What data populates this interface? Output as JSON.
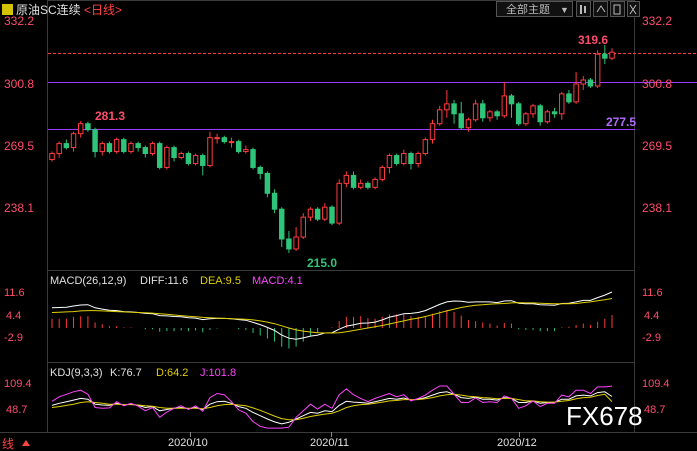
{
  "header": {
    "title": "原油SC连续",
    "period": "<日线>",
    "theme_button": "全部主题",
    "theme_arrow": "▼"
  },
  "main_panel": {
    "y_ticks": [
      "332.2",
      "300.8",
      "269.5",
      "238.1"
    ],
    "annotations": {
      "high_left": "281.3",
      "low": "215.0",
      "high_right": "319.6",
      "support": "277.5"
    }
  },
  "macd_panel": {
    "label": "MACD(26,12,9)",
    "diff": "DIFF:11.6",
    "dea": "DEA:9.5",
    "macd": "MACD:4.1",
    "ticks": [
      "11.6",
      "4.4",
      "-2.9"
    ]
  },
  "kdj_panel": {
    "label": "KDJ(9,3,3)",
    "k": "K:76.7",
    "d": "D:64.2",
    "j": "J:101.8",
    "ticks": [
      "109.4",
      "48.7"
    ]
  },
  "x_axis": {
    "dates": [
      "2020/10",
      "2020/11",
      "2020/12"
    ]
  },
  "footer": {
    "left_text": "线",
    "watermark": "FX678"
  },
  "colors": {
    "up": "#ff3b3b",
    "down": "#2ec47a",
    "purple_line": "#9a3bff",
    "price_line": "#ff3b3b",
    "macd_diff": "#ffffff",
    "macd_dea": "#e0d000",
    "macd_label": "#ff44ff",
    "kdj_j": "#ff44ff"
  },
  "chart_data": {
    "type": "candlestick",
    "title": "原油SC连续 日线",
    "ylim": [
      206,
      340
    ],
    "reference_lines": [
      300.8,
      277.5,
      315.6
    ],
    "candles": [
      [
        262.0,
        265.0,
        261.0,
        266.0
      ],
      [
        265.0,
        270.0,
        263.0,
        271.0
      ],
      [
        270.0,
        268.0,
        267.0,
        272.0
      ],
      [
        268.0,
        275.0,
        266.0,
        276.0
      ],
      [
        275.0,
        280.0,
        273.0,
        281.3
      ],
      [
        280.0,
        277.0,
        276.0,
        281.0
      ],
      [
        277.0,
        266.0,
        263.0,
        278.0
      ],
      [
        266.0,
        270.0,
        264.0,
        271.0
      ],
      [
        270.0,
        266.0,
        265.0,
        271.0
      ],
      [
        266.0,
        272.0,
        265.0,
        273.0
      ],
      [
        272.0,
        266.0,
        265.0,
        273.0
      ],
      [
        266.0,
        270.0,
        265.0,
        271.0
      ],
      [
        270.0,
        268.0,
        266.0,
        271.0
      ],
      [
        268.0,
        265.0,
        263.0,
        269.0
      ],
      [
        265.0,
        270.0,
        264.0,
        271.0
      ],
      [
        270.0,
        258.0,
        257.0,
        271.0
      ],
      [
        258.0,
        268.0,
        257.0,
        269.0
      ],
      [
        268.0,
        263.0,
        261.0,
        269.0
      ],
      [
        263.0,
        265.0,
        262.0,
        266.0
      ],
      [
        265.0,
        260.0,
        259.0,
        266.0
      ],
      [
        260.0,
        264.0,
        259.0,
        265.0
      ],
      [
        264.0,
        259.0,
        254.0,
        265.0
      ],
      [
        259.0,
        273.0,
        258.0,
        276.0
      ],
      [
        273.0,
        273.0,
        270.0,
        275.0
      ],
      [
        273.0,
        271.0,
        270.0,
        274.0
      ],
      [
        271.0,
        271.0,
        268.0,
        273.0
      ],
      [
        271.0,
        266.0,
        265.0,
        272.0
      ],
      [
        266.0,
        267.0,
        265.0,
        269.0
      ],
      [
        267.0,
        258.0,
        257.0,
        268.0
      ],
      [
        258.0,
        255.0,
        252.0,
        259.0
      ],
      [
        255.0,
        245.0,
        243.0,
        256.0
      ],
      [
        245.0,
        237.0,
        235.0,
        247.0
      ],
      [
        237.0,
        222.0,
        218.0,
        238.0
      ],
      [
        222.0,
        217.0,
        215.0,
        226.0
      ],
      [
        217.0,
        223.0,
        216.0,
        228.0
      ],
      [
        223.0,
        233.0,
        222.0,
        235.0
      ],
      [
        233.0,
        237.0,
        231.0,
        238.0
      ],
      [
        237.0,
        232.0,
        231.0,
        238.0
      ],
      [
        232.0,
        238.0,
        231.0,
        240.0
      ],
      [
        238.0,
        230.0,
        229.0,
        239.0
      ],
      [
        230.0,
        250.0,
        229.0,
        252.0
      ],
      [
        250.0,
        254.0,
        248.0,
        256.0
      ],
      [
        254.0,
        248.0,
        247.0,
        256.0
      ],
      [
        248.0,
        250.0,
        247.0,
        252.0
      ],
      [
        250.0,
        248.0,
        247.0,
        251.0
      ],
      [
        248.0,
        252.0,
        247.0,
        253.0
      ],
      [
        252.0,
        258.0,
        251.0,
        259.0
      ],
      [
        258.0,
        264.0,
        255.0,
        265.0
      ],
      [
        264.0,
        260.0,
        259.0,
        265.0
      ],
      [
        260.0,
        265.0,
        259.0,
        267.0
      ],
      [
        265.0,
        260.0,
        257.0,
        266.0
      ],
      [
        260.0,
        265.0,
        258.0,
        266.0
      ],
      [
        265.0,
        272.0,
        264.0,
        273.0
      ],
      [
        272.0,
        280.0,
        270.0,
        282.0
      ],
      [
        280.0,
        287.0,
        279.0,
        289.0
      ],
      [
        287.0,
        290.0,
        283.0,
        297.0
      ],
      [
        290.0,
        285.0,
        280.0,
        292.0
      ],
      [
        285.0,
        278.0,
        277.0,
        291.0
      ],
      [
        278.0,
        282.0,
        276.0,
        283.0
      ],
      [
        282.0,
        290.0,
        281.0,
        292.0
      ],
      [
        290.0,
        283.0,
        281.0,
        292.0
      ],
      [
        283.0,
        286.0,
        281.0,
        287.0
      ],
      [
        286.0,
        284.0,
        282.0,
        287.0
      ],
      [
        284.0,
        294.0,
        283.0,
        301.0
      ],
      [
        294.0,
        290.0,
        283.0,
        295.0
      ],
      [
        290.0,
        280.0,
        279.0,
        291.0
      ],
      [
        280.0,
        285.0,
        279.0,
        286.0
      ],
      [
        285.0,
        289.0,
        283.0,
        290.0
      ],
      [
        289.0,
        281.0,
        279.0,
        290.0
      ],
      [
        281.0,
        286.0,
        280.0,
        287.0
      ],
      [
        286.0,
        285.0,
        283.0,
        288.0
      ],
      [
        285.0,
        295.0,
        282.0,
        296.0
      ],
      [
        295.0,
        291.0,
        290.0,
        297.0
      ],
      [
        291.0,
        300.0,
        290.0,
        306.0
      ],
      [
        300.0,
        302.0,
        297.0,
        304.0
      ],
      [
        302.0,
        299.0,
        298.0,
        303.0
      ],
      [
        299.0,
        315.0,
        298.0,
        317.0
      ],
      [
        315.0,
        313.0,
        310.0,
        319.6
      ],
      [
        313.0,
        316.0,
        312.0,
        318.0
      ]
    ],
    "macd": {
      "series": [
        {
          "name": "DIFF",
          "values": [
            6.5,
            6.6,
            6.7,
            7.1,
            7.4,
            7.5,
            6.5,
            6.1,
            5.7,
            5.6,
            5.3,
            5.2,
            5.0,
            4.7,
            4.6,
            4.0,
            3.9,
            3.7,
            3.6,
            3.3,
            3.2,
            2.7,
            3.0,
            3.1,
            3.1,
            3.0,
            2.7,
            2.5,
            1.8,
            1.1,
            0.2,
            -0.8,
            -2.3,
            -3.3,
            -3.6,
            -3.2,
            -2.6,
            -2.3,
            -1.6,
            -1.5,
            -0.4,
            0.6,
            1.0,
            1.5,
            1.6,
            1.9,
            2.6,
            3.5,
            4.0,
            4.6,
            4.7,
            5.0,
            5.6,
            6.6,
            7.6,
            8.4,
            8.7,
            8.6,
            8.3,
            8.4,
            8.4,
            8.4,
            8.2,
            8.7,
            8.8,
            8.0,
            7.8,
            7.8,
            7.5,
            7.4,
            7.3,
            7.9,
            8.0,
            8.4,
            8.9,
            8.9,
            9.8,
            10.6,
            11.6
          ]
        },
        {
          "name": "DEA",
          "values": [
            5.0,
            5.1,
            5.2,
            5.3,
            5.5,
            5.6,
            5.6,
            5.5,
            5.4,
            5.3,
            5.2,
            5.1,
            5.0,
            4.9,
            4.8,
            4.6,
            4.4,
            4.2,
            4.0,
            3.8,
            3.6,
            3.4,
            3.3,
            3.2,
            3.1,
            3.0,
            2.9,
            2.8,
            2.6,
            2.3,
            1.9,
            1.4,
            0.7,
            0.0,
            -0.6,
            -1.0,
            -1.3,
            -1.5,
            -1.6,
            -1.6,
            -1.5,
            -1.2,
            -0.8,
            -0.4,
            0.0,
            0.4,
            0.8,
            1.3,
            1.8,
            2.3,
            2.8,
            3.2,
            3.7,
            4.3,
            4.9,
            5.5,
            6.1,
            6.6,
            7.0,
            7.3,
            7.5,
            7.7,
            7.8,
            7.9,
            8.1,
            8.2,
            8.1,
            8.1,
            8.0,
            7.9,
            7.8,
            7.8,
            7.8,
            7.9,
            8.2,
            8.4,
            8.8,
            9.1,
            9.5
          ]
        }
      ],
      "labels": {
        "diff": "DIFF:11.6",
        "dea": "DEA:9.5",
        "macd": "MACD:4.1"
      }
    },
    "kdj": {
      "series": [
        {
          "name": "K",
          "values": [
            55,
            60,
            64,
            68,
            72,
            70,
            58,
            56,
            55,
            60,
            56,
            58,
            55,
            50,
            52,
            42,
            45,
            48,
            50,
            47,
            50,
            45,
            58,
            64,
            65,
            60,
            52,
            48,
            38,
            30,
            22,
            15,
            10,
            14,
            22,
            30,
            38,
            36,
            42,
            40,
            55,
            65,
            63,
            62,
            60,
            64,
            68,
            72,
            70,
            73,
            68,
            70,
            74,
            80,
            86,
            88,
            82,
            74,
            72,
            75,
            70,
            70,
            68,
            74,
            72,
            62,
            62,
            66,
            60,
            62,
            62,
            70,
            70,
            78,
            80,
            78,
            86,
            88,
            76.7
          ]
        },
        {
          "name": "D",
          "values": [
            50,
            52,
            55,
            58,
            62,
            64,
            62,
            60,
            58,
            58,
            57,
            57,
            56,
            54,
            53,
            50,
            48,
            48,
            48,
            48,
            48,
            47,
            50,
            54,
            57,
            58,
            56,
            54,
            49,
            43,
            36,
            29,
            23,
            20,
            20,
            24,
            28,
            31,
            34,
            36,
            42,
            50,
            54,
            57,
            58,
            60,
            63,
            66,
            67,
            69,
            69,
            69,
            71,
            74,
            78,
            81,
            82,
            80,
            77,
            76,
            74,
            73,
            71,
            72,
            72,
            69,
            66,
            66,
            64,
            63,
            63,
            65,
            67,
            71,
            74,
            75,
            79,
            82,
            64.2
          ]
        },
        {
          "name": "J",
          "values": [
            65,
            76,
            82,
            88,
            92,
            82,
            50,
            48,
            49,
            64,
            54,
            60,
            53,
            42,
            50,
            26,
            39,
            48,
            54,
            45,
            54,
            41,
            74,
            84,
            81,
            64,
            44,
            36,
            16,
            4,
            0,
            0,
            0,
            2,
            26,
            42,
            58,
            46,
            58,
            48,
            81,
            95,
            81,
            72,
            64,
            72,
            78,
            84,
            76,
            81,
            66,
            72,
            80,
            92,
            102,
            102,
            82,
            62,
            62,
            73,
            62,
            64,
            62,
            78,
            72,
            48,
            54,
            66,
            52,
            60,
            60,
            80,
            76,
            92,
            92,
            84,
            100,
            100,
            101.8
          ]
        }
      ],
      "labels": {
        "k": "K:76.7",
        "d": "D:64.2",
        "j": "J:101.8"
      }
    }
  }
}
